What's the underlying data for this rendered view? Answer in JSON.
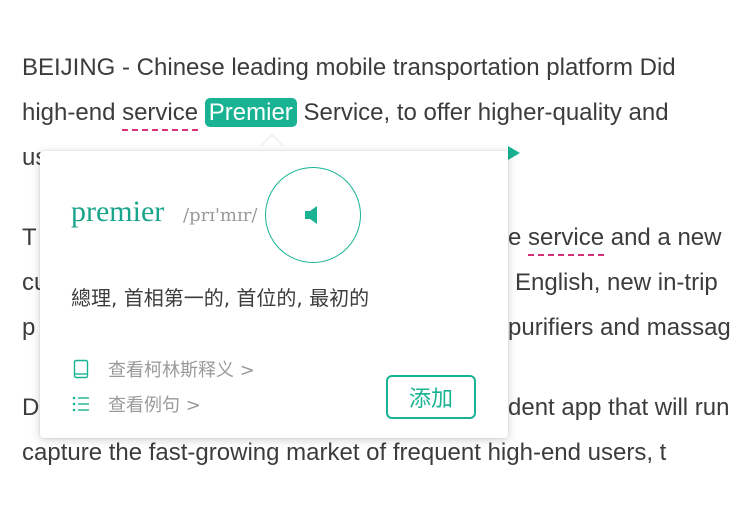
{
  "article": {
    "p1": {
      "line1": "BEIJING - Chinese leading mobile transportation platform Did",
      "line2_before": "high-end ",
      "line2_service": "service",
      "line2_highlight": "Premier",
      "line2_after": " Service, to offer higher-quality and",
      "line3_start": "us"
    },
    "p2": {
      "line4_start": "T",
      "line4_mid": "e ",
      "line4_service": "service",
      "line4_end": " and a new",
      "line5_start": "cu",
      "line5_end": "English, new in-trip",
      "line6_start": "p",
      "line6_end": "purifiers and massag"
    },
    "p3": {
      "line7_start": "D",
      "line7_end": "dent app that will run",
      "line8": "capture the fast-growing market of frequent high-end users, t"
    }
  },
  "popup": {
    "word": "premier",
    "phonetic": "/prɪ'mɪr/",
    "speaker_icon": "speaker-icon",
    "meaning": "總理, 首相第一的, 首位的, 最初的",
    "collins_link": "查看柯林斯释义 >",
    "examples_link": "查看例句 >",
    "add_button": "添加"
  },
  "colors": {
    "accent": "#19b394",
    "underline": "#d6317a"
  }
}
